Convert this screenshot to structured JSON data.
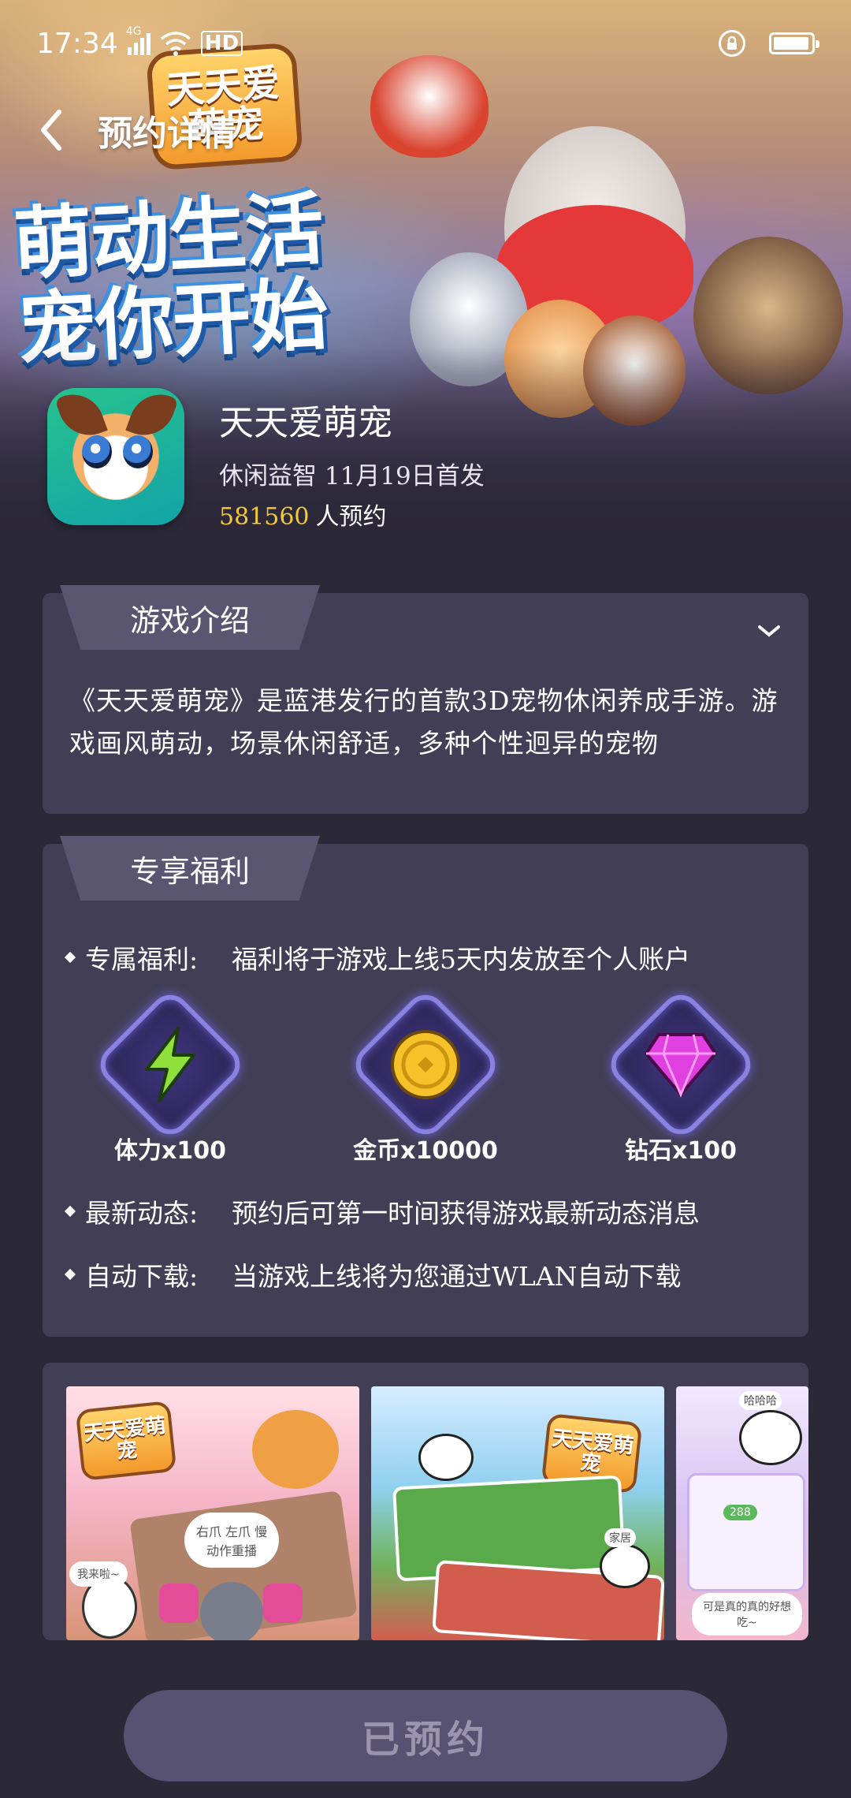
{
  "status_bar": {
    "time": "17:34",
    "network": "4G",
    "hd": "HD",
    "icons": [
      "signal-icon",
      "wifi-icon",
      "hd-icon",
      "lock-icon",
      "battery-icon"
    ]
  },
  "nav": {
    "title": "预约详情",
    "back_icon": "back-arrow-icon"
  },
  "hero": {
    "logo_text": "天天爱萌宠",
    "slogan_line1": "萌动生活",
    "slogan_line2": "宠你开始"
  },
  "app": {
    "name": "天天爱萌宠",
    "meta": "休闲益智 11月19日首发",
    "reserve_count": "581560",
    "reserve_suffix": "人预约"
  },
  "intro": {
    "tab_label": "游戏介绍",
    "text": "《天天爱萌宠》是蓝港发行的首款3D宠物休闲养成手游。游戏画风萌动，场景休闲舒适，多种个性迥异的宠物",
    "expand_icon": "chevron-down-icon"
  },
  "benefits": {
    "tab_label": "专享福利",
    "items": [
      {
        "label": "专属福利:",
        "value": "福利将于游戏上线5天内发放至个人账户"
      },
      {
        "label": "最新动态:",
        "value": "预约后可第一时间获得游戏最新动态消息"
      },
      {
        "label": "自动下载:",
        "value": "当游戏上线将为您通过WLAN自动下载"
      }
    ],
    "rewards": [
      {
        "icon": "lightning-icon",
        "label": "体力x100",
        "color": "#8fe03a"
      },
      {
        "icon": "gold-coin-icon",
        "label": "金币x10000",
        "color": "#f5c22a"
      },
      {
        "icon": "diamond-icon",
        "label": "钻石x100",
        "color": "#e040e0"
      }
    ]
  },
  "screenshots": {
    "logo_text": "天天爱萌宠",
    "shot1_bubble": "右爪 左爪 慢动作重播",
    "shot1_tag": "我来啦~",
    "shot2_tag": "家居",
    "shot3_top": "哈哈哈",
    "shot3_bubble": "可是真的真的好想吃~",
    "shot3_value": "288"
  },
  "bottom": {
    "reserved_label": "已预约"
  },
  "colors": {
    "background": "#2b2838",
    "card": "#423e55",
    "card_tab": "#5a5570",
    "highlight": "#f5c93a",
    "button": "#575172",
    "button_text": "#9a95ad"
  }
}
